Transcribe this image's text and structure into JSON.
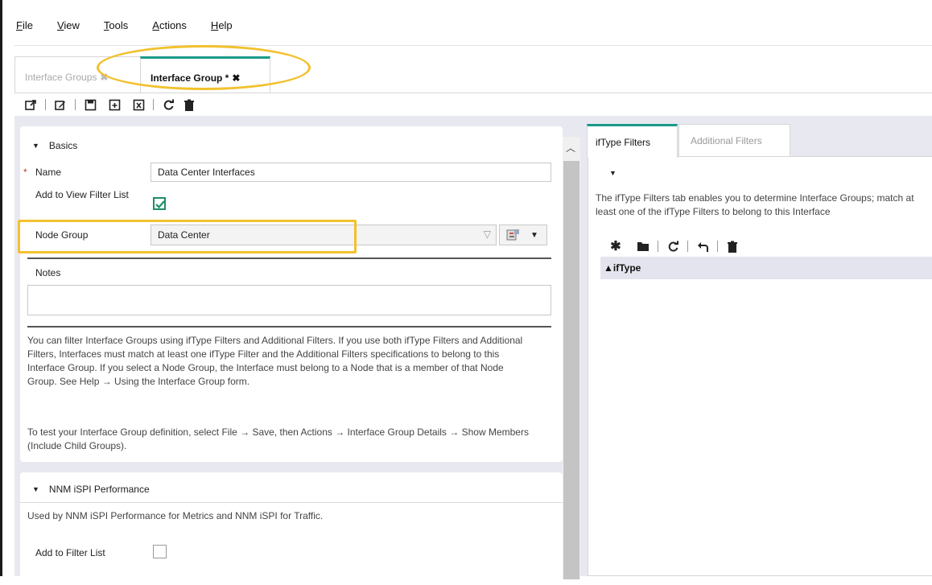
{
  "menu": {
    "items": [
      {
        "first": "F",
        "rest": "ile"
      },
      {
        "first": "V",
        "rest": "iew"
      },
      {
        "first": "T",
        "rest": "ools"
      },
      {
        "first": "A",
        "rest": "ctions"
      },
      {
        "first": "H",
        "rest": "elp"
      }
    ]
  },
  "tabs": [
    {
      "label": "Interface Groups",
      "close": "✖"
    },
    {
      "label": "Interface Group *",
      "close": "✖"
    }
  ],
  "toolbar_icons": [
    "open-icon",
    "edit-icon",
    "save-icon",
    "save-and-new-icon",
    "save-and-close-icon",
    "refresh-icon",
    "delete-icon"
  ],
  "basics": {
    "header": "Basics",
    "required_mark": "*",
    "name_label": "Name",
    "name_value": "Data Center Interfaces",
    "add_view_filter_label": "Add to View Filter List",
    "add_view_filter_checked": true,
    "node_group_label": "Node Group",
    "node_group_value": "Data Center",
    "notes_label": "Notes",
    "notes_value": "",
    "help_text_1": "You can filter Interface Groups using ifType Filters and Additional Filters. If you use both ifType Filters and Additional Filters, Interfaces must match at least one ifType Filter and the Additional Filters specifications to belong to this Interface Group. If you select a Node Group, the Interface must belong to a Node that is a member of that Node Group. See Help → Using the Interface Group form.",
    "help_text_2": "To test your Interface Group definition, select File → Save, then Actions → Interface Group Details → Show Members (Include Child Groups)."
  },
  "perf": {
    "header": "NNM iSPI Performance",
    "description": "Used by NNM iSPI Performance for Metrics and NNM iSPI for Traffic.",
    "add_filter_label": "Add to Filter List",
    "add_filter_checked": false
  },
  "right": {
    "tabs": [
      "ifType Filters",
      "Additional Filters"
    ],
    "description": "The ifType Filters tab enables you to determine Interface Groups; match at least one of the ifType Filters to belong to this Interface",
    "grid_header": "▲ifType",
    "toolbar_icons": [
      "new-icon",
      "open-folder-icon",
      "refresh-icon",
      "undo-icon",
      "delete-icon"
    ]
  },
  "colors": {
    "accent": "#1a9a8a",
    "highlight": "#f2c12e",
    "check": "#1d8d6a"
  }
}
